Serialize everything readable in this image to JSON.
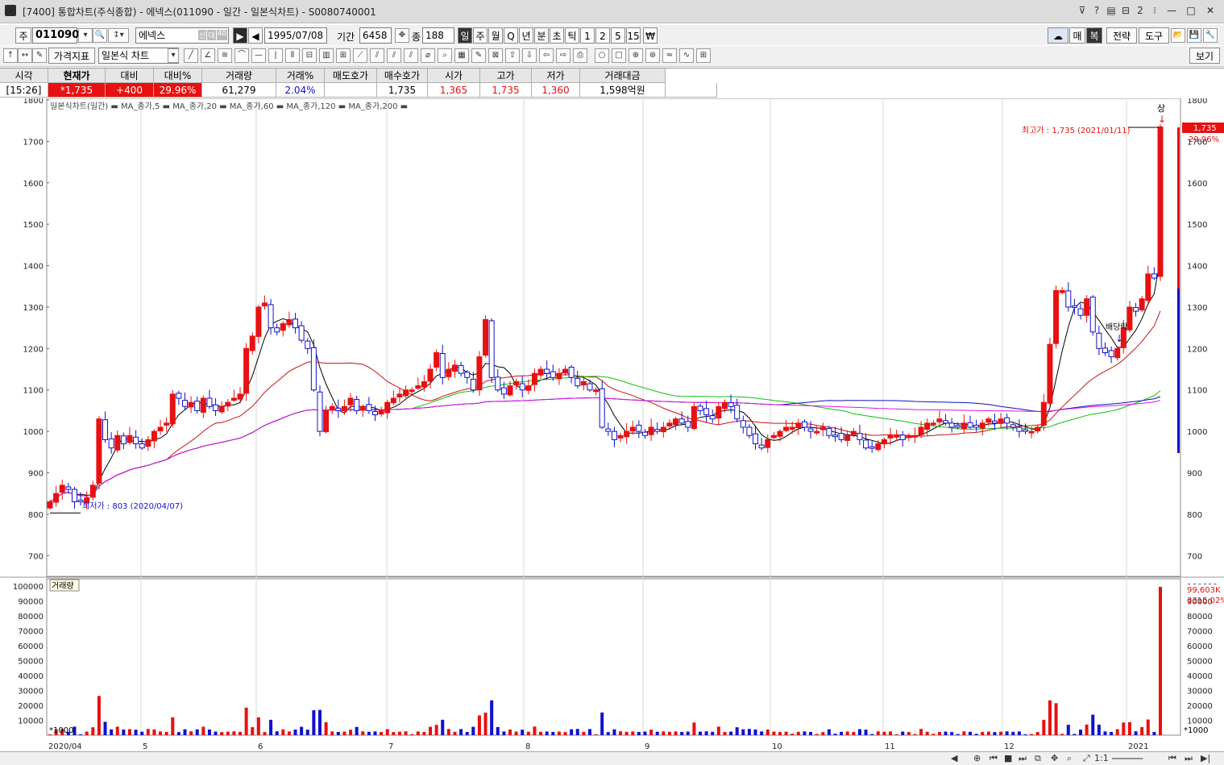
{
  "window": {
    "title": "[7400] 통합차트(주식종합) - 에넥스(011090 - 일간 - 일본식차트) - S0080740001",
    "icons": [
      "pin-icon",
      "help-icon",
      "layout-icon",
      "split-icon",
      "count-icon",
      "minimize-icon",
      "maximize-icon",
      "close-icon"
    ],
    "count_label": "2"
  },
  "toolbar1": {
    "prefix": "주",
    "code": "011090",
    "name": "에넥스",
    "name_badges": [
      "신",
      "대",
      "40"
    ],
    "date": "1995/07/08",
    "period_label": "기간",
    "period_value": "6458",
    "count_label": "종",
    "count_value": "188",
    "timeframes": [
      "일",
      "주",
      "월",
      "Q",
      "년",
      "분",
      "초",
      "틱",
      "1",
      "2",
      "5",
      "15"
    ],
    "currency": "₩",
    "right_buttons": [
      "매",
      "복",
      "전략",
      "도구"
    ]
  },
  "toolbar2": {
    "indicator_label": "가격지표",
    "chart_type": "일본식 차트",
    "view_label": "보기"
  },
  "quote": {
    "headers": [
      "시각",
      "현재가",
      "대비",
      "대비%",
      "거래량",
      "거래%",
      "매도호가",
      "매수호가",
      "시가",
      "고가",
      "저가",
      "거래대금"
    ],
    "values": [
      "[15:26]",
      "*1,735",
      "+400",
      "29.96%",
      "61,279",
      "2.04%",
      "",
      "1,735",
      "1,365",
      "1,735",
      "1,360",
      "1,598억원"
    ]
  },
  "chart_legend": "일본식차트(일간) ▬ MA_종가,5 ▬ MA_종가,20 ▬ MA_종가,60 ▬ MA_종가,120 ▬ MA_종가,200 ▬",
  "annotations": {
    "high": "최고가 : 1,735 (2021/01/11)",
    "low": "최저가 : 803 (2020/04/07)",
    "upper_limit": "상",
    "dividend": "배당락",
    "last_price": "1,735",
    "last_change": "29.96%",
    "volume_label": "거래량",
    "volume_last": "99,603K",
    "volume_pct": "3315.02%",
    "volume_unit": "*1000"
  },
  "colors": {
    "up": "#e81010",
    "down": "#1010d0",
    "ma5": "#000000",
    "ma20": "#d01010",
    "ma60": "#10c010",
    "ma120": "#1010c0",
    "ma200": "#e010e0"
  },
  "chart_data": {
    "type": "candlestick",
    "price_axis_ticks": [
      700,
      800,
      900,
      1000,
      1100,
      1200,
      1300,
      1400,
      1500,
      1600,
      1700,
      1800
    ],
    "ylim": [
      650,
      1800
    ],
    "volume_axis_ticks": [
      10000,
      20000,
      30000,
      40000,
      50000,
      60000,
      70000,
      80000,
      90000,
      100000
    ],
    "x_labels": [
      "2020/04",
      "5",
      "6",
      "7",
      "8",
      "9",
      "10",
      "11",
      "12",
      "2021"
    ],
    "closes": [
      830,
      850,
      870,
      860,
      830,
      830,
      840,
      870,
      1030,
      980,
      960,
      990,
      970,
      990,
      970,
      960,
      980,
      1000,
      1010,
      1020,
      1090,
      1080,
      1060,
      1070,
      1050,
      1080,
      1060,
      1050,
      1060,
      1070,
      1080,
      1090,
      1200,
      1230,
      1300,
      1310,
      1250,
      1240,
      1260,
      1270,
      1250,
      1220,
      1200,
      1100,
      1000,
      1050,
      1060,
      1050,
      1060,
      1080,
      1050,
      1060,
      1050,
      1040,
      1050,
      1070,
      1080,
      1090,
      1100,
      1100,
      1110,
      1120,
      1150,
      1190,
      1130,
      1150,
      1160,
      1140,
      1130,
      1100,
      1180,
      1270,
      1130,
      1100,
      1090,
      1110,
      1120,
      1100,
      1110,
      1140,
      1150,
      1140,
      1130,
      1140,
      1150,
      1130,
      1110,
      1120,
      1100,
      1100,
      1010,
      1000,
      980,
      990,
      1000,
      1010,
      1000,
      990,
      1010,
      1000,
      1010,
      1020,
      1030,
      1020,
      1010,
      1060,
      1050,
      1040,
      1030,
      1060,
      1070,
      1060,
      1030,
      1010,
      990,
      970,
      960,
      980,
      990,
      1000,
      1010,
      1010,
      1020,
      1010,
      1000,
      1000,
      1010,
      990,
      990,
      980,
      990,
      1000,
      980,
      960,
      960,
      970,
      980,
      990,
      990,
      980,
      990,
      990,
      1010,
      1020,
      1020,
      1030,
      1020,
      1010,
      1010,
      1020,
      1010,
      1010,
      1020,
      1030,
      1020,
      1030,
      1020,
      1010,
      1000,
      1000,
      1000,
      1010,
      1070,
      1210,
      1340,
      1340,
      1300,
      1300,
      1280,
      1320,
      1240,
      1200,
      1190,
      1180,
      1200,
      1250,
      1300,
      1290,
      1320,
      1380,
      1370,
      1735
    ]
  }
}
